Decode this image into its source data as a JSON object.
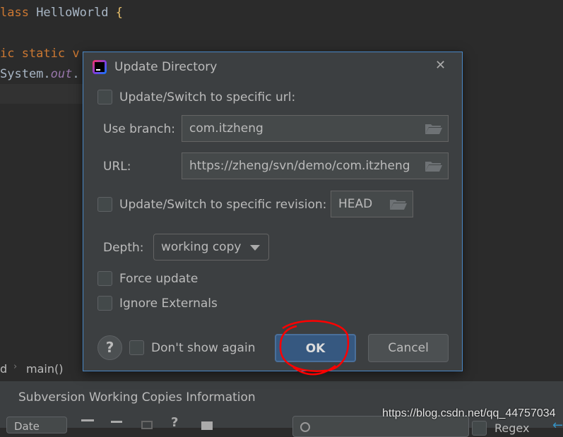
{
  "editor": {
    "line1": {
      "kw": "lass",
      "name": " HelloWorld ",
      "brace": "{"
    },
    "line3": {
      "text": "ic static v"
    },
    "line4": {
      "prefix": "System.",
      "field": "out",
      "suffix": "."
    }
  },
  "breadcrumb": {
    "left": "d",
    "sep": "›",
    "item": "main()"
  },
  "dialog": {
    "title": "Update Directory",
    "close": "✕",
    "switch_url_label": "Update/Switch to specific url:",
    "use_branch_label": "Use branch:",
    "use_branch_value": "com.itzheng",
    "url_label": "URL:",
    "url_value": "https://zheng/svn/demo/com.itzheng",
    "switch_revision_label": "Update/Switch to specific revision:",
    "revision_value": "HEAD",
    "depth_label": "Depth:",
    "depth_value": "working copy",
    "force_update_label": "Force update",
    "ignore_externals_label": "Ignore Externals",
    "help": "?",
    "dont_show_label": "Don't show again",
    "ok_label": "OK",
    "cancel_label": "Cancel",
    "accent": "#4a88c7",
    "ok_color": "#365880"
  },
  "panel": {
    "title": "Subversion Working Copies Information",
    "sort_value": "Date",
    "regex_label": "Regex",
    "watermark": "https://blog.csdn.net/qq_44757034"
  }
}
